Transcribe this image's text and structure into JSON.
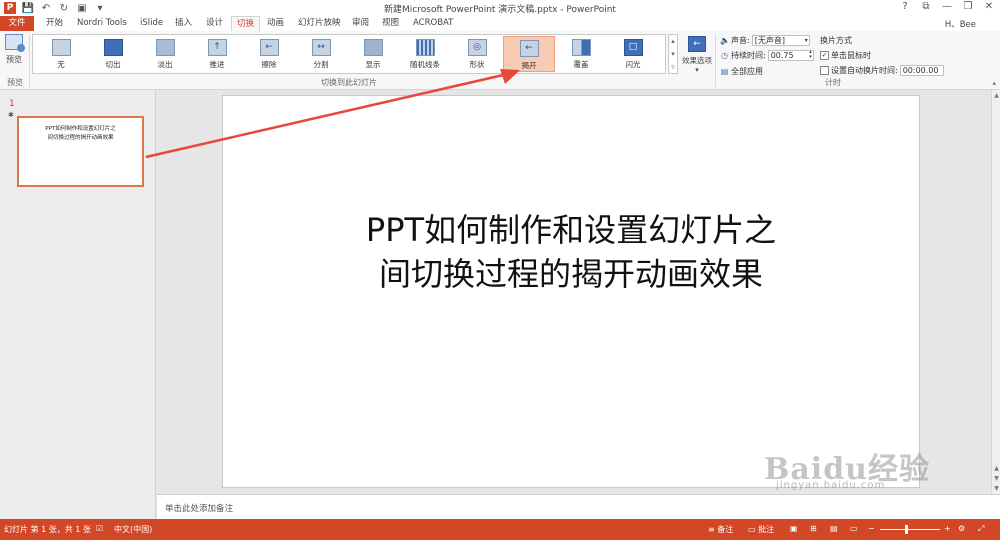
{
  "window": {
    "title": "新建Microsoft PowerPoint 演示文稿.pptx - PowerPoint",
    "controls": [
      "?",
      "⧉",
      "—",
      "❐",
      "✕"
    ]
  },
  "qat": {
    "app_icon": "P",
    "items": [
      "save-icon",
      "undo-icon",
      "redo-icon",
      "slideshow-icon",
      "customize-icon"
    ]
  },
  "tabs": [
    {
      "label": "文件"
    },
    {
      "label": "开始"
    },
    {
      "label": "Nordri Tools"
    },
    {
      "label": "iSlide"
    },
    {
      "label": "插入"
    },
    {
      "label": "设计"
    },
    {
      "label": "切换"
    },
    {
      "label": "动画"
    },
    {
      "label": "幻灯片放映"
    },
    {
      "label": "审阅"
    },
    {
      "label": "视图"
    },
    {
      "label": "ACROBAT"
    }
  ],
  "active_tab": "切换",
  "user": {
    "name": "H、Bee"
  },
  "ribbon": {
    "preview": {
      "label": "预览",
      "group": "预览"
    },
    "transitions_group": "切换到此幻灯片",
    "transitions": [
      {
        "label": "无"
      },
      {
        "label": "切出"
      },
      {
        "label": "淡出"
      },
      {
        "label": "推进"
      },
      {
        "label": "擦除"
      },
      {
        "label": "分割"
      },
      {
        "label": "显示"
      },
      {
        "label": "随机线条"
      },
      {
        "label": "形状"
      },
      {
        "label": "揭开"
      },
      {
        "label": "覆盖"
      },
      {
        "label": "闪光"
      }
    ],
    "selected_transition": "揭开",
    "effect_options": "效果选项",
    "timing": {
      "sound_label": "声音:",
      "sound_value": "[无声音]",
      "duration_label": "持续时间:",
      "duration_value": "00.75",
      "apply_all": "全部应用",
      "advance_heading": "换片方式",
      "on_click_label": "单击鼠标时",
      "on_click_checked": true,
      "auto_label": "设置自动换片时间:",
      "auto_checked": false,
      "auto_value": "00:00.00",
      "group": "计时"
    }
  },
  "slide_panel": {
    "number": "1",
    "star": "✱",
    "thumb_lines": [
      "PPT如何制作和设置幻灯片之",
      "间切换过程的揭开动画效果"
    ]
  },
  "slide": {
    "title_lines": [
      "PPT如何制作和设置幻灯片之",
      "间切换过程的揭开动画效果"
    ]
  },
  "notes_placeholder": "单击此处添加备注",
  "status": {
    "slide_info": "幻灯片 第 1 张，共 1 张",
    "language": "中文(中国)",
    "notes": "备注",
    "comments": "批注"
  },
  "watermark": {
    "brand": "Baidu经验",
    "url": "jingyan.baidu.com"
  },
  "colors": {
    "accent": "#d24726",
    "selected_fill": "#f8cbb3",
    "arrow": "#e8473a"
  }
}
